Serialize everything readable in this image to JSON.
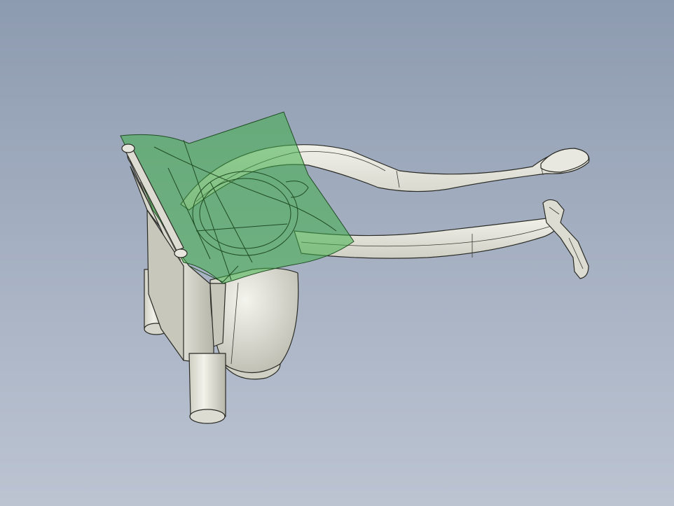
{
  "scene": {
    "background_top": "#8d9bb0",
    "background_bottom": "#bcc4d2",
    "part_color": "#e4e4dc",
    "part_shadow_color": "#b9b9ad",
    "section_plane_color": "#3fae48",
    "edge_color": "#2b2b26"
  },
  "model": {
    "parts": [
      "base-body",
      "bowl",
      "upper-handle",
      "lower-handle",
      "legs",
      "hinge-pin"
    ],
    "section_plane_visible": true
  }
}
